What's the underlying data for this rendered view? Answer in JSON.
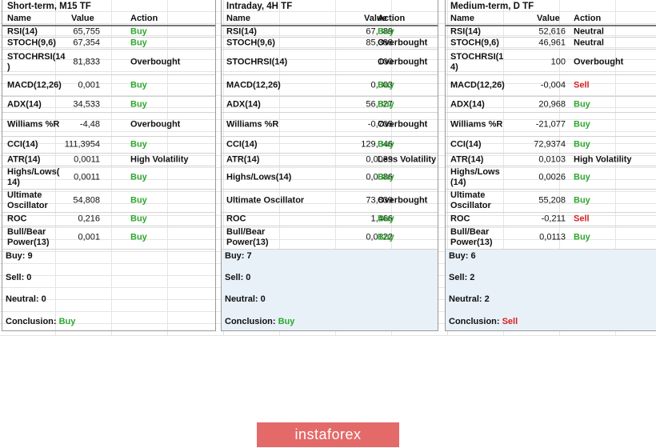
{
  "columns": {
    "name": "Name",
    "value": "Value",
    "action": "Action"
  },
  "panels": [
    {
      "title": "Short-term, M15 TF",
      "rows": [
        {
          "name": "RSI(14)",
          "value": "65,755",
          "action": "Buy",
          "kind": "buy"
        },
        {
          "name": "STOCH(9,6)",
          "value": "67,354",
          "action": "Buy",
          "kind": "buy"
        },
        {
          "name": "STOCHRSI(14\n)",
          "value": "81,833",
          "action": "Overbought",
          "kind": "over"
        },
        {
          "name": "MACD(12,26)",
          "value": "0,001",
          "action": "Buy",
          "kind": "buy"
        },
        {
          "name": "ADX(14)",
          "value": "34,533",
          "action": "Buy",
          "kind": "buy"
        },
        {
          "name": "Williams %R",
          "value": "-4,48",
          "action": "Overbought",
          "kind": "over"
        },
        {
          "name": "CCI(14)",
          "value": "111,3954",
          "action": "Buy",
          "kind": "buy"
        },
        {
          "name": "ATR(14)",
          "value": "0,0011",
          "action": "High Volatility",
          "kind": "hv"
        },
        {
          "name": "Highs/Lows(\n14)",
          "value": "0,0011",
          "action": "Buy",
          "kind": "buy"
        },
        {
          "name": "Ultimate\nOscillator",
          "value": "54,808",
          "action": "Buy",
          "kind": "buy"
        },
        {
          "name": "ROC",
          "value": "0,216",
          "action": "Buy",
          "kind": "buy"
        },
        {
          "name": "Bull/Bear\nPower(13)",
          "value": "0,001",
          "action": "Buy",
          "kind": "buy"
        }
      ],
      "summary": {
        "buy": "Buy: 9",
        "sell": "Sell: 0",
        "neutral": "Neutral: 0",
        "conclusion_label": "Conclusion:",
        "conclusion": "Buy",
        "conclusion_kind": "buy"
      }
    },
    {
      "title": "Intraday, 4H TF",
      "rows": [
        {
          "name": "RSI(14)",
          "value": "67,389",
          "action": "Buy",
          "kind": "buy"
        },
        {
          "name": "STOCH(9,6)",
          "value": "85,388",
          "action": "Overbought",
          "kind": "over"
        },
        {
          "name": "STOCHRSI(14)",
          "value": "100",
          "action": "Overbought",
          "kind": "over"
        },
        {
          "name": "MACD(12,26)",
          "value": "0,003",
          "action": "Buy",
          "kind": "buy"
        },
        {
          "name": "ADX(14)",
          "value": "56,827",
          "action": "Buy",
          "kind": "buy"
        },
        {
          "name": "Williams %R",
          "value": "-0,705",
          "action": "Overbought",
          "kind": "over"
        },
        {
          "name": "CCI(14)",
          "value": "129,346",
          "action": "Buy",
          "kind": "buy"
        },
        {
          "name": "ATR(14)",
          "value": "0,0039",
          "action": "Less Volatility",
          "kind": "lv"
        },
        {
          "name": "Highs/Lows(14)",
          "value": "0,0086",
          "action": "Buy",
          "kind": "buy"
        },
        {
          "name": "Ultimate Oscillator",
          "value": "73,839",
          "action": "Overbought",
          "kind": "over"
        },
        {
          "name": "ROC",
          "value": "1,466",
          "action": "Buy",
          "kind": "buy"
        },
        {
          "name": "Bull/Bear\nPower(13)",
          "value": "0,0122",
          "action": "Buy",
          "kind": "buy"
        }
      ],
      "summary": {
        "buy": "Buy: 7",
        "sell": "Sell: 0",
        "neutral": "Neutral: 0",
        "conclusion_label": "Conclusion:",
        "conclusion": "Buy",
        "conclusion_kind": "buy"
      }
    },
    {
      "title": "Medium-term, D TF",
      "rows": [
        {
          "name": "RSI(14)",
          "value": "52,616",
          "action": "Neutral",
          "kind": "neutral"
        },
        {
          "name": "STOCH(9,6)",
          "value": "46,961",
          "action": "Neutral",
          "kind": "neutral"
        },
        {
          "name": "STOCHRSI(1\n4)",
          "value": "100",
          "action": "Overbought",
          "kind": "over"
        },
        {
          "name": "MACD(12,26)",
          "value": "-0,004",
          "action": "Sell",
          "kind": "sell"
        },
        {
          "name": "ADX(14)",
          "value": "20,968",
          "action": "Buy",
          "kind": "buy"
        },
        {
          "name": "Williams %R",
          "value": "-21,077",
          "action": "Buy",
          "kind": "buy"
        },
        {
          "name": "CCI(14)",
          "value": "72,9374",
          "action": "Buy",
          "kind": "buy"
        },
        {
          "name": "ATR(14)",
          "value": "0,0103",
          "action": "High Volatility",
          "kind": "hv"
        },
        {
          "name": "Highs/Lows\n(14)",
          "value": "0,0026",
          "action": "Buy",
          "kind": "buy"
        },
        {
          "name": "Ultimate\nOscillator",
          "value": "55,208",
          "action": "Buy",
          "kind": "buy"
        },
        {
          "name": "ROC",
          "value": "-0,211",
          "action": "Sell",
          "kind": "sell"
        },
        {
          "name": "Bull/Bear\nPower(13)",
          "value": "0,0113",
          "action": "Buy",
          "kind": "buy"
        }
      ],
      "summary": {
        "buy": "Buy: 6",
        "sell": "Sell: 2",
        "neutral": "Neutral: 2",
        "conclusion_label": "Conclusion:",
        "conclusion": "Sell",
        "conclusion_kind": "sell"
      }
    }
  ],
  "logo": "instaforex",
  "colors": {
    "buy": "#2ea82e",
    "sell": "#d82020",
    "logo_bg": "#e46a6a",
    "summary_shade": "#e8f0f8"
  }
}
